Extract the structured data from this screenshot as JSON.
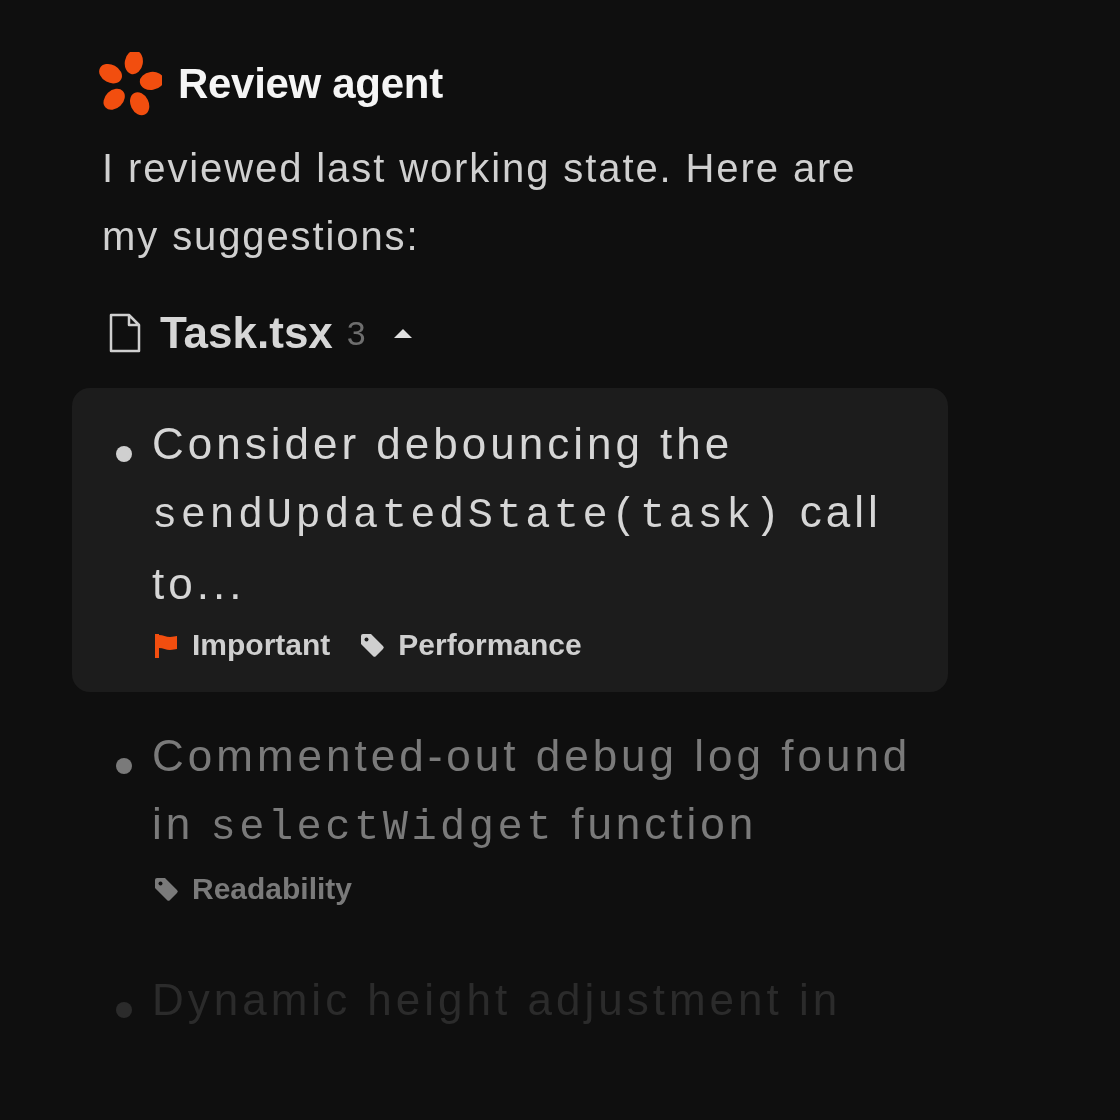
{
  "agent": {
    "name": "Review agent"
  },
  "message": "I reviewed last working state. Here are my suggestions:",
  "file": {
    "name": "Task.tsx",
    "count": "3",
    "expanded": true
  },
  "suggestions": [
    {
      "kind": "focused",
      "parts": [
        {
          "text": "Consider debouncing the ",
          "code": false
        },
        {
          "text": "sendUpdatedState(task)",
          "code": true
        },
        {
          "text": " call to...",
          "code": false
        }
      ],
      "tags": [
        {
          "kind": "flag",
          "label": "Important"
        },
        {
          "kind": "tag",
          "label": "Performance"
        }
      ]
    },
    {
      "kind": "muted",
      "parts": [
        {
          "text": "Commented-out debug log found in ",
          "code": false
        },
        {
          "text": "selectWidget",
          "code": true
        },
        {
          "text": " function",
          "code": false
        }
      ],
      "tags": [
        {
          "kind": "tag",
          "label": "Readability"
        }
      ]
    },
    {
      "kind": "faded",
      "parts": [
        {
          "text": "Dynamic height adjustment in",
          "code": false
        }
      ]
    }
  ]
}
